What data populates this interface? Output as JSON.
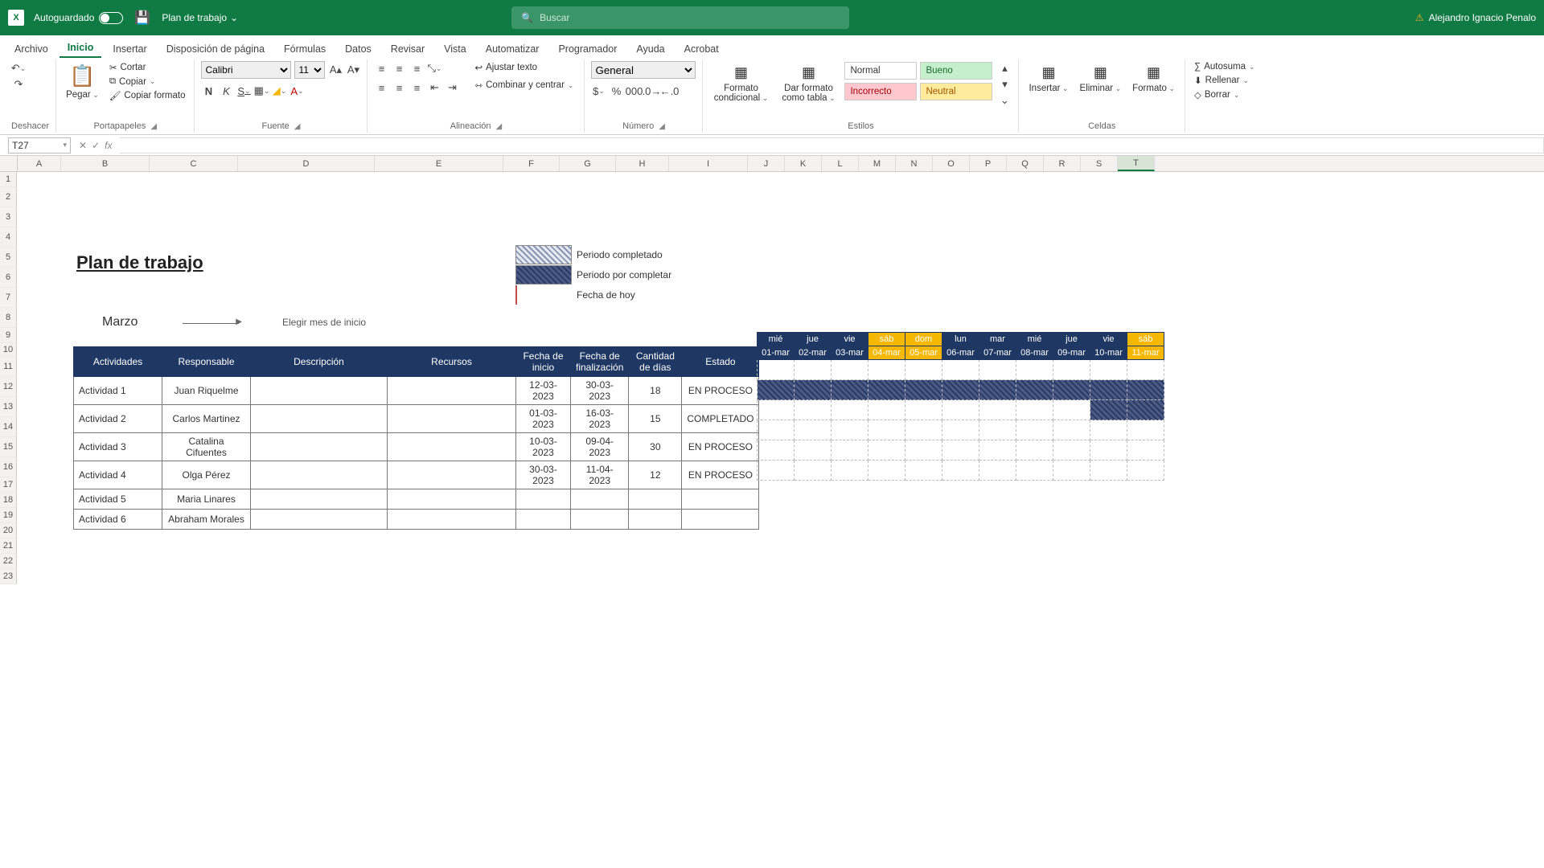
{
  "titlebar": {
    "autosave": "Autoguardado",
    "docname": "Plan de trabajo",
    "search_placeholder": "Buscar",
    "user": "Alejandro Ignacio Penalo"
  },
  "tabs": [
    "Archivo",
    "Inicio",
    "Insertar",
    "Disposición de página",
    "Fórmulas",
    "Datos",
    "Revisar",
    "Vista",
    "Automatizar",
    "Programador",
    "Ayuda",
    "Acrobat"
  ],
  "active_tab": "Inicio",
  "ribbon": {
    "undo_group": "Deshacer",
    "clipboard": {
      "paste": "Pegar",
      "cut": "Cortar",
      "copy": "Copiar",
      "format_painter": "Copiar formato",
      "label": "Portapapeles"
    },
    "font": {
      "name": "Calibri",
      "size": "11",
      "label": "Fuente",
      "bold": "N",
      "italic": "K",
      "underline": "S"
    },
    "alignment": {
      "wrap": "Ajustar texto",
      "merge": "Combinar y centrar",
      "label": "Alineación"
    },
    "number": {
      "format": "General",
      "label": "Número"
    },
    "styles": {
      "cond": "Formato condicional",
      "table": "Dar formato como tabla",
      "normal": "Normal",
      "bueno": "Bueno",
      "incorrecto": "Incorrecto",
      "neutral": "Neutral",
      "label": "Estilos"
    },
    "cells": {
      "insert": "Insertar",
      "delete": "Eliminar",
      "format": "Formato",
      "label": "Celdas"
    },
    "editing": {
      "autosum": "Autosuma",
      "fill": "Rellenar",
      "clear": "Borrar"
    }
  },
  "namebox": "T27",
  "columns": [
    "A",
    "B",
    "C",
    "D",
    "E",
    "F",
    "G",
    "H",
    "I",
    "J",
    "K",
    "L",
    "M",
    "N",
    "O",
    "P",
    "Q",
    "R",
    "S",
    "T"
  ],
  "doc": {
    "title": "Plan de trabajo",
    "month": "Marzo",
    "hint": "Elegir mes de inicio",
    "legend": {
      "completed": "Periodo completado",
      "pending": "Periodo por completar",
      "today": "Fecha de hoy"
    }
  },
  "plan_headers": {
    "act": "Actividades",
    "resp": "Responsable",
    "desc": "Descripción",
    "rec": "Recursos",
    "fi": "Fecha de inicio",
    "ff": "Fecha de finalización",
    "cd": "Cantidad de días",
    "est": "Estado"
  },
  "days": [
    {
      "dow": "mié",
      "date": "01-mar",
      "we": false
    },
    {
      "dow": "jue",
      "date": "02-mar",
      "we": false
    },
    {
      "dow": "vie",
      "date": "03-mar",
      "we": false
    },
    {
      "dow": "sáb",
      "date": "04-mar",
      "we": true
    },
    {
      "dow": "dom",
      "date": "05-mar",
      "we": true
    },
    {
      "dow": "lun",
      "date": "06-mar",
      "we": false
    },
    {
      "dow": "mar",
      "date": "07-mar",
      "we": false
    },
    {
      "dow": "mié",
      "date": "08-mar",
      "we": false
    },
    {
      "dow": "jue",
      "date": "09-mar",
      "we": false
    },
    {
      "dow": "vie",
      "date": "10-mar",
      "we": false
    },
    {
      "dow": "sáb",
      "date": "11-mar",
      "we": true
    }
  ],
  "activities": [
    {
      "act": "Actividad 1",
      "resp": "Juan Riquelme",
      "fi": "12-03-2023",
      "ff": "30-03-2023",
      "cd": "18",
      "est": "EN PROCESO",
      "bar": []
    },
    {
      "act": "Actividad 2",
      "resp": "Carlos Martinez",
      "fi": "01-03-2023",
      "ff": "16-03-2023",
      "cd": "15",
      "est": "COMPLETADO",
      "bar": [
        0,
        1,
        2,
        3,
        4,
        5,
        6,
        7,
        8,
        9,
        10
      ]
    },
    {
      "act": "Actividad 3",
      "resp": "Catalina Cifuentes",
      "fi": "10-03-2023",
      "ff": "09-04-2023",
      "cd": "30",
      "est": "EN PROCESO",
      "bar": [
        9,
        10
      ]
    },
    {
      "act": "Actividad 4",
      "resp": "Olga Pérez",
      "fi": "30-03-2023",
      "ff": "11-04-2023",
      "cd": "12",
      "est": "EN PROCESO",
      "bar": []
    },
    {
      "act": "Actividad 5",
      "resp": "Maria Linares",
      "fi": "",
      "ff": "",
      "cd": "",
      "est": "",
      "bar": []
    },
    {
      "act": "Actividad 6",
      "resp": "Abraham Morales",
      "fi": "",
      "ff": "",
      "cd": "",
      "est": "",
      "bar": []
    }
  ]
}
